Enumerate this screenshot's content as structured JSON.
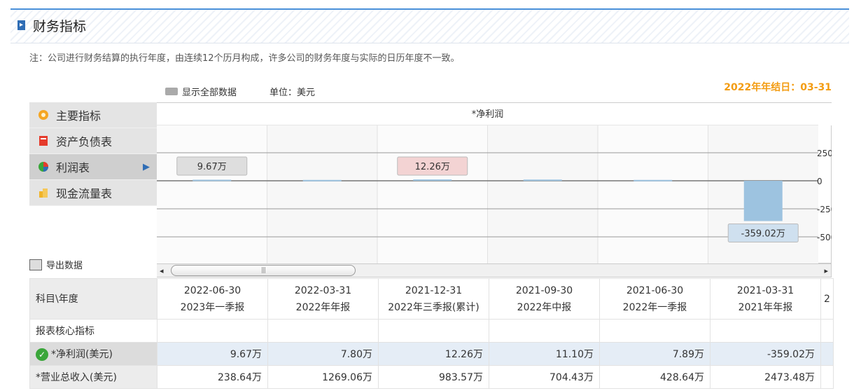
{
  "header": {
    "marker": "▸",
    "title": "财务指标"
  },
  "note": "注：公司进行财务结算的执行年度，由连续12个历月构成，许多公司的财务年度与实际的日历年度不一致。",
  "toolbar": {
    "show_all": "显示全部数据",
    "unit": "单位：美元"
  },
  "year_end": "2022年年结日：03-31",
  "sidebar": {
    "items": [
      {
        "label": "主要指标",
        "icon": "flower-icon"
      },
      {
        "label": "资产负债表",
        "icon": "document-icon"
      },
      {
        "label": "利润表",
        "icon": "pie-chart-icon",
        "active": true
      },
      {
        "label": "现金流量表",
        "icon": "coins-icon"
      }
    ],
    "arrow": "▶"
  },
  "export": "导出数据",
  "scrollbar": {
    "left": "◂",
    "right": "▸",
    "grip": "|||"
  },
  "chart_data": {
    "type": "bar",
    "title": "*净利润",
    "categories": [
      "2022-06-30",
      "2022-03-31",
      "2021-12-31",
      "2021-09-30",
      "2021-06-30",
      "2021-03-31"
    ],
    "values": [
      9.67,
      7.8,
      12.26,
      11.1,
      7.89,
      -359.02
    ],
    "ylim": [
      -600,
      450
    ],
    "yticks": [
      250,
      0,
      -250,
      -500
    ],
    "ytick_labels": [
      "250",
      "0",
      "-250",
      "-500"
    ],
    "callouts": [
      {
        "index": 0,
        "text": "9.67万",
        "bg": "#dedede"
      },
      {
        "index": 2,
        "text": "12.26万",
        "bg": "#f3d3d3"
      },
      {
        "index": 5,
        "text": "-359.02万",
        "bg": "#cfe0ef"
      }
    ],
    "bar_color": "#9dc3e0",
    "grid": true
  },
  "table": {
    "corner": "科目\\年度",
    "columns": [
      {
        "date": "2022-06-30",
        "period": "2023年一季报"
      },
      {
        "date": "2022-03-31",
        "period": "2022年年报"
      },
      {
        "date": "2021-12-31",
        "period": "2022年三季报(累计)"
      },
      {
        "date": "2021-09-30",
        "period": "2022年中报"
      },
      {
        "date": "2021-06-30",
        "period": "2022年一季报"
      },
      {
        "date": "2021-03-31",
        "period": "2021年年报"
      }
    ],
    "overflow_hint": "2",
    "section": "报表核心指标",
    "rows": [
      {
        "label": "*净利润(美元)",
        "values": [
          "9.67万",
          "7.80万",
          "12.26万",
          "11.10万",
          "7.89万",
          "-359.02万"
        ],
        "checked": true
      },
      {
        "label": "*营业总收入(美元)",
        "values": [
          "238.64万",
          "1269.06万",
          "983.57万",
          "704.43万",
          "428.64万",
          "2473.48万"
        ]
      }
    ]
  }
}
